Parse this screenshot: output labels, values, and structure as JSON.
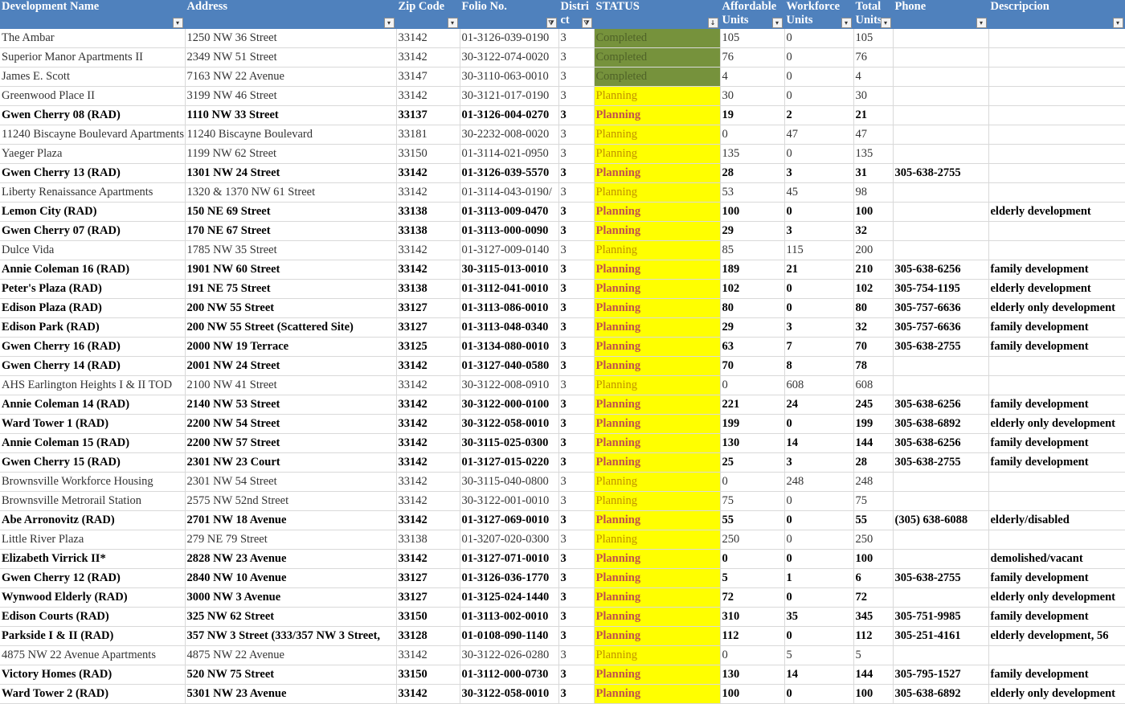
{
  "columns": [
    {
      "label": "Development Name"
    },
    {
      "label": "Address"
    },
    {
      "label": "Zip Code"
    },
    {
      "label": "Folio No."
    },
    {
      "label": "Distri\nct"
    },
    {
      "label": "STATUS"
    },
    {
      "label": "Affordable\nUnits"
    },
    {
      "label": "Workforce\nUnits"
    },
    {
      "label": "Total\nUnits"
    },
    {
      "label": "Phone"
    },
    {
      "label": "Descripcion"
    }
  ],
  "filter_icons": {
    "plain": "▾",
    "filtered": "⧩",
    "sorted": "↓"
  },
  "status_colors": {
    "Completed": "#76923c",
    "Planning": "#ffff00"
  },
  "rows": [
    {
      "bold": false,
      "cells": [
        "The Ambar",
        "1250 NW 36 Street",
        "33142",
        "01-3126-039-0190",
        "3",
        "Completed",
        "105",
        "0",
        "105",
        "",
        ""
      ]
    },
    {
      "bold": false,
      "cells": [
        "Superior Manor Apartments II",
        "2349 NW 51 Street",
        "33142",
        "30-3122-074-0020",
        "3",
        "Completed",
        "76",
        "0",
        "76",
        "",
        ""
      ]
    },
    {
      "bold": false,
      "cells": [
        "James E. Scott",
        "7163 NW 22 Avenue",
        "33147",
        "30-3110-063-0010",
        "3",
        "Completed",
        "4",
        "0",
        "4",
        "",
        ""
      ]
    },
    {
      "bold": false,
      "cells": [
        "Greenwood Place II",
        " 3199 NW 46 Street",
        "33142",
        "30-3121-017-0190",
        "3",
        "Planning",
        "30",
        "0",
        "30",
        "",
        ""
      ]
    },
    {
      "bold": true,
      "cells": [
        "Gwen Cherry 08 (RAD)",
        "1110 NW 33 Street",
        "33137",
        "01-3126-004-0270",
        "3",
        "Planning",
        "19",
        "2",
        "21",
        "",
        ""
      ]
    },
    {
      "bold": false,
      "cells": [
        "11240 Biscayne Boulevard Apartments",
        "11240 Biscayne Boulevard",
        "33181",
        "30-2232-008-0020",
        "3",
        "Planning",
        "0",
        "47",
        "47",
        "",
        ""
      ]
    },
    {
      "bold": false,
      "cells": [
        "Yaeger Plaza",
        "1199 NW 62 Street",
        "33150",
        "01-3114-021-0950",
        "3",
        "Planning",
        "135",
        "0",
        "135",
        "",
        ""
      ]
    },
    {
      "bold": true,
      "cells": [
        "Gwen Cherry 13 (RAD)",
        "1301 NW 24 Street",
        "33142",
        "01-3126-039-5570",
        "3",
        "Planning",
        "28",
        "3",
        "31",
        "305-638-2755",
        ""
      ]
    },
    {
      "bold": false,
      "cells": [
        "Liberty Renaissance Apartments",
        "1320 & 1370 NW 61 Street",
        "33142",
        "01-3114-043-0190/",
        "3",
        "Planning",
        "53",
        "45",
        "98",
        "",
        ""
      ]
    },
    {
      "bold": true,
      "cells": [
        "Lemon City (RAD)",
        "150 NE 69 Street",
        "33138",
        "01-3113-009-0470",
        "3",
        "Planning",
        "100",
        "0",
        "100",
        "",
        "elderly development"
      ]
    },
    {
      "bold": true,
      "cells": [
        "Gwen Cherry 07 (RAD)",
        "170 NE 67 Street",
        "33138",
        "01-3113-000-0090",
        "3",
        "Planning",
        "29",
        "3",
        "32",
        "",
        ""
      ]
    },
    {
      "bold": false,
      "cells": [
        "Dulce Vida",
        "1785 NW 35 Street",
        "33142",
        "01-3127-009-0140",
        "3",
        "Planning",
        "85",
        "115",
        "200",
        "",
        ""
      ]
    },
    {
      "bold": true,
      "cells": [
        "Annie Coleman 16 (RAD)",
        "1901 NW 60 Street",
        "33142",
        "30-3115-013-0010",
        "3",
        "Planning",
        "189",
        "21",
        "210",
        "305-638-6256",
        "family development"
      ]
    },
    {
      "bold": true,
      "cells": [
        "Peter's Plaza (RAD)",
        "191 NE 75 Street",
        "33138",
        "01-3112-041-0010",
        "3",
        "Planning",
        "102",
        "0",
        "102",
        "305-754-1195",
        "elderly development"
      ]
    },
    {
      "bold": true,
      "cells": [
        "Edison Plaza (RAD)",
        "200 NW 55 Street",
        "33127",
        "01-3113-086-0010",
        "3",
        "Planning",
        "80",
        "0",
        "80",
        "305-757-6636",
        "elderly only development"
      ]
    },
    {
      "bold": true,
      "cells": [
        "Edison Park  (RAD)",
        "200 NW 55 Street (Scattered Site)",
        "33127",
        "01-3113-048-0340",
        "3",
        "Planning",
        "29",
        "3",
        "32",
        "305-757-6636",
        "family development"
      ]
    },
    {
      "bold": true,
      "cells": [
        "Gwen Cherry 16 (RAD)",
        "2000 NW 19 Terrace",
        "33125",
        "01-3134-080-0010",
        "3",
        "Planning",
        "63",
        "7",
        "70",
        "305-638-2755",
        "family development"
      ]
    },
    {
      "bold": true,
      "cells": [
        "Gwen Cherry 14 (RAD)",
        "2001 NW 24 Street",
        "33142",
        "01-3127-040-0580",
        "3",
        "Planning",
        "70",
        "8",
        "78",
        "",
        ""
      ]
    },
    {
      "bold": false,
      "cells": [
        "AHS Earlington Heights I & II TOD",
        "2100 NW 41 Street",
        "33142",
        "30-3122-008-0910",
        "3",
        "Planning",
        "0",
        "608",
        "608",
        "",
        ""
      ]
    },
    {
      "bold": true,
      "cells": [
        "Annie Coleman 14 (RAD)",
        "2140 NW 53 Street",
        "33142",
        "30-3122-000-0100",
        "3",
        "Planning",
        "221",
        "24",
        "245",
        "305-638-6256",
        "family development"
      ]
    },
    {
      "bold": true,
      "cells": [
        "Ward Tower 1 (RAD)",
        "2200 NW 54 Street",
        "33142",
        "30-3122-058-0010",
        "3",
        "Planning",
        "199",
        "0",
        "199",
        "305-638-6892",
        "elderly only development"
      ]
    },
    {
      "bold": true,
      "cells": [
        "Annie Coleman 15 (RAD)",
        "2200 NW 57 Street",
        "33142",
        "30-3115-025-0300",
        "3",
        "Planning",
        "130",
        "14",
        "144",
        "305-638-6256",
        "family development"
      ]
    },
    {
      "bold": true,
      "cells": [
        "Gwen Cherry 15 (RAD)",
        "2301 NW 23 Court",
        "33142",
        "01-3127-015-0220",
        "3",
        "Planning",
        "25",
        "3",
        "28",
        "305-638-2755",
        "family development"
      ]
    },
    {
      "bold": false,
      "cells": [
        "Brownsville Workforce Housing",
        "2301 NW 54 Street",
        "33142",
        "30-3115-040-0800",
        "3",
        "Planning",
        "0",
        "248",
        "248",
        "",
        ""
      ]
    },
    {
      "bold": false,
      "cells": [
        "Brownsville Metrorail Station",
        "2575 NW 52nd Street",
        "33142",
        "30-3122-001-0010",
        "3",
        "Planning",
        "75",
        "0",
        "75",
        "",
        ""
      ]
    },
    {
      "bold": true,
      "cells": [
        "Abe Arronovitz (RAD)",
        "2701 NW 18 Avenue",
        "33142",
        "01-3127-069-0010",
        "3",
        "Planning",
        "55",
        "0",
        "55",
        "(305) 638-6088",
        "elderly/disabled"
      ]
    },
    {
      "bold": false,
      "cells": [
        "Little River Plaza",
        "279 NE 79 Street",
        "33138",
        "01-3207-020-0300",
        "3",
        "Planning",
        "250",
        "0",
        "250",
        "",
        ""
      ]
    },
    {
      "bold": true,
      "cells": [
        "Elizabeth Virrick II*",
        "2828 NW 23 Avenue",
        "33142",
        "01-3127-071-0010",
        "3",
        "Planning",
        "0",
        "0",
        "100",
        "",
        "demolished/vacant"
      ]
    },
    {
      "bold": true,
      "cells": [
        "Gwen Cherry 12 (RAD)",
        "2840 NW 10 Avenue",
        "33127",
        "01-3126-036-1770",
        "3",
        "Planning",
        "5",
        "1",
        "6",
        "305-638-2755",
        "family development"
      ]
    },
    {
      "bold": true,
      "cells": [
        "Wynwood Elderly (RAD)",
        "3000 NW 3 Avenue",
        "33127",
        "01-3125-024-1440",
        "3",
        "Planning",
        "72",
        "0",
        "72",
        "",
        "elderly only development"
      ]
    },
    {
      "bold": true,
      "cells": [
        "Edison Courts (RAD)",
        "325 NW 62 Street",
        "33150",
        "01-3113-002-0010",
        "3",
        "Planning",
        "310",
        "35",
        "345",
        "305-751-9985",
        "family development"
      ]
    },
    {
      "bold": true,
      "cells": [
        "Parkside I & II (RAD)",
        "357 NW 3 Street (333/357 NW 3 Street,",
        "33128",
        "01-0108-090-1140",
        "3",
        "Planning",
        "112",
        "0",
        "112",
        "305-251-4161",
        "elderly development, 56"
      ]
    },
    {
      "bold": false,
      "cells": [
        "4875 NW 22 Avenue Apartments",
        "4875 NW 22 Avenue",
        "33142",
        "30-3122-026-0280",
        "3",
        "Planning",
        "0",
        "5",
        "5",
        "",
        ""
      ]
    },
    {
      "bold": true,
      "cells": [
        "Victory Homes (RAD)",
        "520 NW 75 Street",
        "33150",
        "01-3112-000-0730",
        "3",
        "Planning",
        "130",
        "14",
        "144",
        "305-795-1527",
        "family development"
      ]
    },
    {
      "bold": true,
      "cells": [
        "Ward Tower 2 (RAD)",
        "5301 NW 23 Avenue",
        "33142",
        "30-3122-058-0010",
        "3",
        "Planning",
        "100",
        "0",
        "100",
        "305-638-6892",
        "elderly only development"
      ]
    }
  ]
}
